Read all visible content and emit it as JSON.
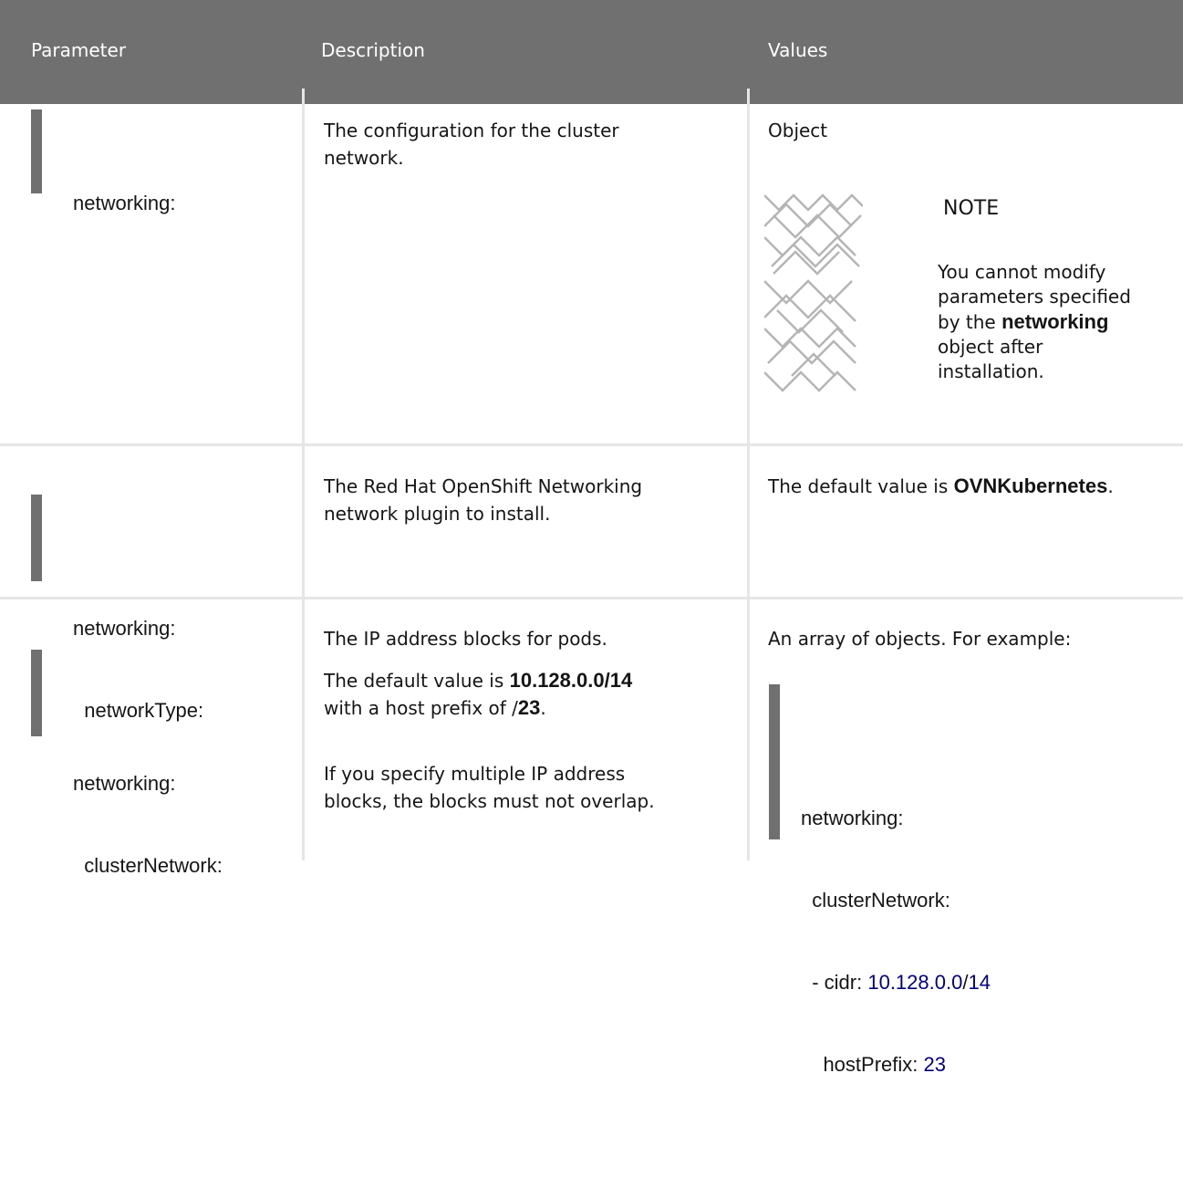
{
  "columns": [
    "Parameter",
    "Description",
    "Values"
  ],
  "rows": [
    {
      "parameter": [
        "networking:"
      ],
      "description": [
        "The configuration for the cluster",
        "network."
      ],
      "value_label": "Object",
      "note": {
        "title": "NOTE",
        "line1": "You cannot modify",
        "line2": "parameters specified",
        "line3_pre": "by the ",
        "line3_bold": "networking",
        "line4": "object after",
        "line5": "installation."
      }
    },
    {
      "parameter": [
        "networking:",
        "  networkType:"
      ],
      "description": [
        "The Red Hat OpenShift Networking",
        "network plugin to install."
      ],
      "value_pre": "The default value is ",
      "value_bold": "OVNKubernetes",
      "value_post": "."
    },
    {
      "parameter": [
        "networking:",
        "  clusterNetwork:"
      ],
      "description_1": "The IP address blocks for pods.",
      "description_2_pre": "The default value is ",
      "description_2_bold": "10.128.0.0/14",
      "description_3_pre": "with a host prefix of /",
      "description_3_bold": "23",
      "description_3_post": ".",
      "description_4": [
        "If you specify multiple IP address",
        "blocks, the blocks must not overlap."
      ],
      "value_label": "An array of objects. For example:",
      "example": {
        "line1": "networking:",
        "line2": "  clusterNetwork:",
        "line3_pre": "  - cidr: ",
        "line3_num": "10.128.0.0",
        "line3_sep": "/",
        "line3_num2": "14",
        "line4_pre": "    hostPrefix: ",
        "line4_num": "23"
      }
    }
  ],
  "colors": {
    "header": "#707070",
    "accent_bar": "#707070",
    "number": "#000080"
  }
}
